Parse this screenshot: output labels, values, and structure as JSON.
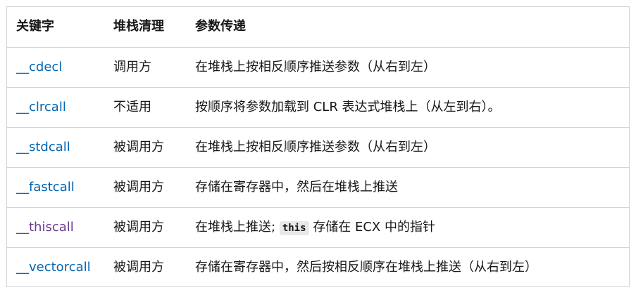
{
  "table": {
    "headers": [
      "关键字",
      "堆栈清理",
      "参数传递"
    ],
    "rows": [
      {
        "keyword": "__cdecl",
        "cleanup": "调用方",
        "params": "在堆栈上按相反顺序推送参数（从右到左）"
      },
      {
        "keyword": "__clrcall",
        "cleanup": "不适用",
        "params": "按顺序将参数加载到 CLR 表达式堆栈上（从左到右）。"
      },
      {
        "keyword": "__stdcall",
        "cleanup": "被调用方",
        "params": "在堆栈上按相反顺序推送参数（从右到左）"
      },
      {
        "keyword": "__fastcall",
        "cleanup": "被调用方",
        "params": "存储在寄存器中，然后在堆栈上推送"
      },
      {
        "keyword": "__thiscall",
        "cleanup": "被调用方",
        "params_before": "在堆栈上推送;",
        "params_code": "this",
        "params_after": "存储在 ECX 中的指针"
      },
      {
        "keyword": "__vectorcall",
        "cleanup": "被调用方",
        "params": "存储在寄存器中，然后按相反顺序在堆栈上推送（从右到左）"
      }
    ]
  },
  "colors": {
    "link": "#0065b3",
    "link_visited": "#6b3a8f",
    "border": "#d4d4d4",
    "code_bg": "#e8e8e8"
  }
}
